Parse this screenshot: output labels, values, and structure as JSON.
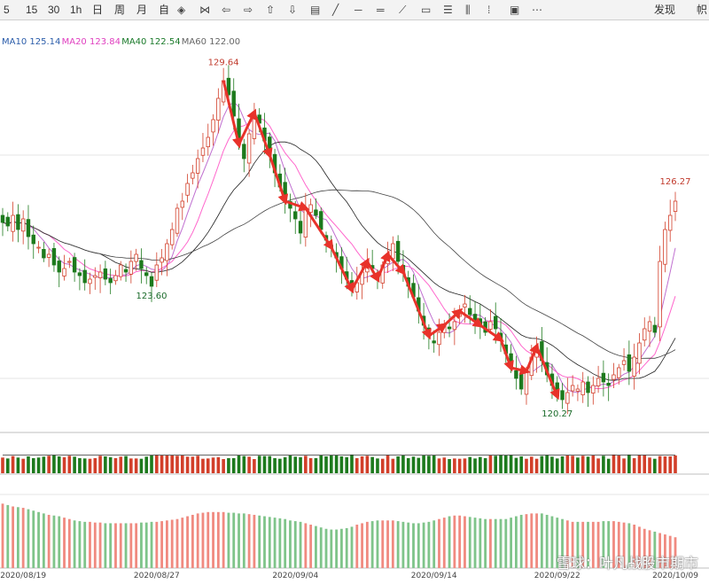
{
  "toolbar": {
    "periods": [
      "5",
      "15",
      "30",
      "1h",
      "日",
      "周",
      "月",
      "自"
    ],
    "icons": [
      "cursor-icon",
      "zoom-icon",
      "arrow-left-icon",
      "arrow-right-icon",
      "arrow-up-icon",
      "arrow-down-icon",
      "grid-icon",
      "line-icon",
      "hline-icon",
      "parallel-icon",
      "ray-icon",
      "rect-icon",
      "text-icon",
      "bars-icon",
      "vline-icon",
      "box-icon",
      "dots-icon"
    ],
    "publish_label": "发现",
    "right_label": "帜"
  },
  "ma_legend": [
    {
      "label": "MA10",
      "value": "125.14",
      "color": "#2a5caa"
    },
    {
      "label": "MA20",
      "value": "123.84",
      "color": "#e040c0"
    },
    {
      "label": "MA40",
      "value": "122.54",
      "color": "#1a7a2a"
    },
    {
      "label": "MA60",
      "value": "122.00",
      "color": "#666666"
    }
  ],
  "annotations": [
    {
      "text": "129.64",
      "color": "#c0392b"
    },
    {
      "text": "123.60",
      "color": "#1a6b2a"
    },
    {
      "text": "126.27",
      "color": "#c0392b"
    },
    {
      "text": "120.27",
      "color": "#1a6b2a"
    }
  ],
  "x_labels": [
    "2020/08/19",
    "2020/08/27",
    "2020/09/04",
    "2020/09/14",
    "2020/09/22",
    "2020/10/09"
  ],
  "watermark": "雪球：叶凡战股市期市",
  "chart_data": {
    "type": "candlestick",
    "annotations": [
      {
        "label": "129.64",
        "value": 129.64,
        "type": "high"
      },
      {
        "label": "123.60",
        "value": 123.6,
        "type": "low"
      },
      {
        "label": "126.27",
        "value": 126.27,
        "type": "high"
      },
      {
        "label": "120.27",
        "value": 120.27,
        "type": "low"
      }
    ],
    "x_labels": [
      "2020/08/19",
      "2020/08/27",
      "2020/09/04",
      "2020/09/14",
      "2020/09/22",
      "2020/10/09"
    ],
    "ylim": [
      119.5,
      130.3
    ],
    "close": [
      125.4,
      125.3,
      125.6,
      125.2,
      125.5,
      125.0,
      124.8,
      124.7,
      124.4,
      124.5,
      124.2,
      124.0,
      124.1,
      124.3,
      124.0,
      123.9,
      123.7,
      123.8,
      123.9,
      124.0,
      123.8,
      123.7,
      123.9,
      124.2,
      124.0,
      124.3,
      124.5,
      124.1,
      123.9,
      123.6,
      124.2,
      124.4,
      124.8,
      125.2,
      125.8,
      126.0,
      126.5,
      126.8,
      127.2,
      127.5,
      127.8,
      128.3,
      128.9,
      129.4,
      129.0,
      128.4,
      127.6,
      127.2,
      127.9,
      128.5,
      128.2,
      127.7,
      127.3,
      126.8,
      126.4,
      126.0,
      125.8,
      125.5,
      125.1,
      125.8,
      125.9,
      125.6,
      125.2,
      124.9,
      124.7,
      124.4,
      124.1,
      123.8,
      123.5,
      123.7,
      124.0,
      124.3,
      124.1,
      123.8,
      124.2,
      124.5,
      124.8,
      124.3,
      124.0,
      123.6,
      123.3,
      122.9,
      122.5,
      122.2,
      122.0,
      122.3,
      122.5,
      122.4,
      122.6,
      122.9,
      123.1,
      122.8,
      122.6,
      122.5,
      122.3,
      122.6,
      122.4,
      122.1,
      121.7,
      121.3,
      121.0,
      120.7,
      121.2,
      121.6,
      121.9,
      121.5,
      121.1,
      120.8,
      120.5,
      120.4,
      120.6,
      120.8,
      120.7,
      120.9,
      120.6,
      120.8,
      121.0,
      120.9,
      120.8,
      121.1,
      121.3,
      121.5,
      121.2,
      121.6,
      122.0,
      122.4,
      122.6,
      122.3,
      124.3,
      125.2,
      125.6,
      126.0
    ],
    "volume": [
      0.52,
      0.49,
      0.57,
      0.52,
      0.48,
      0.56,
      0.5,
      0.52,
      0.55,
      0.58,
      0.61,
      0.56,
      0.53,
      0.58,
      0.55,
      0.5,
      0.49,
      0.48,
      0.5,
      0.58,
      0.56,
      0.53,
      0.5,
      0.55,
      0.57,
      0.49,
      0.49,
      0.48,
      0.55,
      0.59,
      0.61,
      0.59,
      0.59,
      0.59,
      0.58,
      0.59,
      0.55,
      0.55,
      0.58,
      0.48,
      0.49,
      0.52,
      0.53,
      0.47,
      0.5,
      0.5,
      0.6,
      0.57,
      0.55,
      0.47,
      0.58,
      0.57,
      0.57,
      0.5,
      0.48,
      0.53,
      0.6,
      0.55,
      0.53,
      0.58,
      0.5,
      0.5,
      0.59,
      0.56,
      0.59,
      0.59,
      0.56,
      0.53,
      0.62,
      0.5,
      0.56,
      0.58,
      0.54,
      0.49,
      0.48,
      0.61,
      0.48,
      0.56,
      0.6,
      0.5,
      0.55,
      0.51,
      0.6,
      0.58,
      0.6,
      0.49,
      0.52,
      0.47,
      0.49,
      0.48,
      0.49,
      0.54,
      0.49,
      0.54,
      0.5,
      0.59,
      0.58,
      0.61,
      0.6,
      0.61,
      0.51,
      0.56,
      0.48,
      0.55,
      0.48,
      0.57,
      0.61,
      0.55,
      0.49,
      0.56,
      0.59,
      0.58,
      0.52,
      0.58,
      0.55,
      0.6,
      0.49,
      0.58,
      0.48,
      0.62,
      0.59,
      0.49,
      0.62,
      0.5,
      0.61,
      0.61,
      0.52,
      0.48,
      0.57,
      0.56,
      0.56,
      0.59
    ],
    "oscillator": [
      0.92,
      0.9,
      0.88,
      0.87,
      0.86,
      0.84,
      0.82,
      0.8,
      0.78,
      0.76,
      0.75,
      0.74,
      0.72,
      0.7,
      0.68,
      0.67,
      0.66,
      0.66,
      0.65,
      0.65,
      0.64,
      0.64,
      0.64,
      0.64,
      0.64,
      0.64,
      0.64,
      0.65,
      0.65,
      0.66,
      0.66,
      0.67,
      0.68,
      0.69,
      0.7,
      0.72,
      0.74,
      0.76,
      0.78,
      0.79,
      0.8,
      0.8,
      0.8,
      0.8,
      0.79,
      0.79,
      0.78,
      0.78,
      0.77,
      0.76,
      0.75,
      0.74,
      0.73,
      0.72,
      0.71,
      0.7,
      0.68,
      0.67,
      0.66,
      0.64,
      0.62,
      0.6,
      0.58,
      0.56,
      0.55,
      0.55,
      0.56,
      0.57,
      0.59,
      0.62,
      0.64,
      0.66,
      0.67,
      0.68,
      0.68,
      0.68,
      0.68,
      0.67,
      0.66,
      0.65,
      0.64,
      0.64,
      0.65,
      0.66,
      0.68,
      0.7,
      0.72,
      0.74,
      0.75,
      0.75,
      0.74,
      0.73,
      0.72,
      0.71,
      0.7,
      0.7,
      0.7,
      0.7,
      0.7,
      0.72,
      0.74,
      0.76,
      0.77,
      0.78,
      0.78,
      0.78,
      0.76,
      0.74,
      0.72,
      0.7,
      0.68,
      0.66,
      0.66,
      0.66,
      0.66,
      0.66,
      0.66,
      0.67,
      0.67,
      0.67,
      0.66,
      0.65,
      0.64,
      0.62,
      0.59,
      0.56,
      0.54,
      0.52,
      0.5,
      0.48,
      0.46,
      0.44
    ]
  }
}
